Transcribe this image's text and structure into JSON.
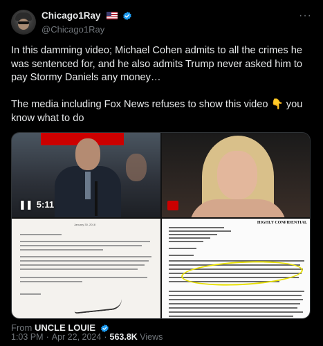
{
  "author": {
    "display_name": "Chicago1Ray",
    "handle": "@Chicago1Ray",
    "flag_icon": "us-flag-icon",
    "verified_color": "#1d9bf0"
  },
  "more_label": "···",
  "tweet": {
    "paragraph_1": "In this damming video; Michael Cohen admits to all the crimes he was sentenced for, and he also admits Trump never asked him to pay Stormy Daniels any money…",
    "paragraph_2": "The media including Fox News refuses to show this video 👇 you know what to do"
  },
  "media": {
    "video_duration": "5:11",
    "letter_date": "January 30, 2018",
    "doc_header": "HIGHLY CONFIDENTIAL"
  },
  "source": {
    "prefix": "From",
    "name": "UNCLE LOUIE"
  },
  "meta": {
    "time": "1:03 PM",
    "date": "Apr 22, 2024",
    "views_count": "563.8K",
    "views_label": "Views"
  },
  "colors": {
    "background": "#000000",
    "text_primary": "#e7e9ea",
    "text_secondary": "#71767b",
    "verified": "#1d9bf0",
    "highlight": "#e8e000"
  }
}
